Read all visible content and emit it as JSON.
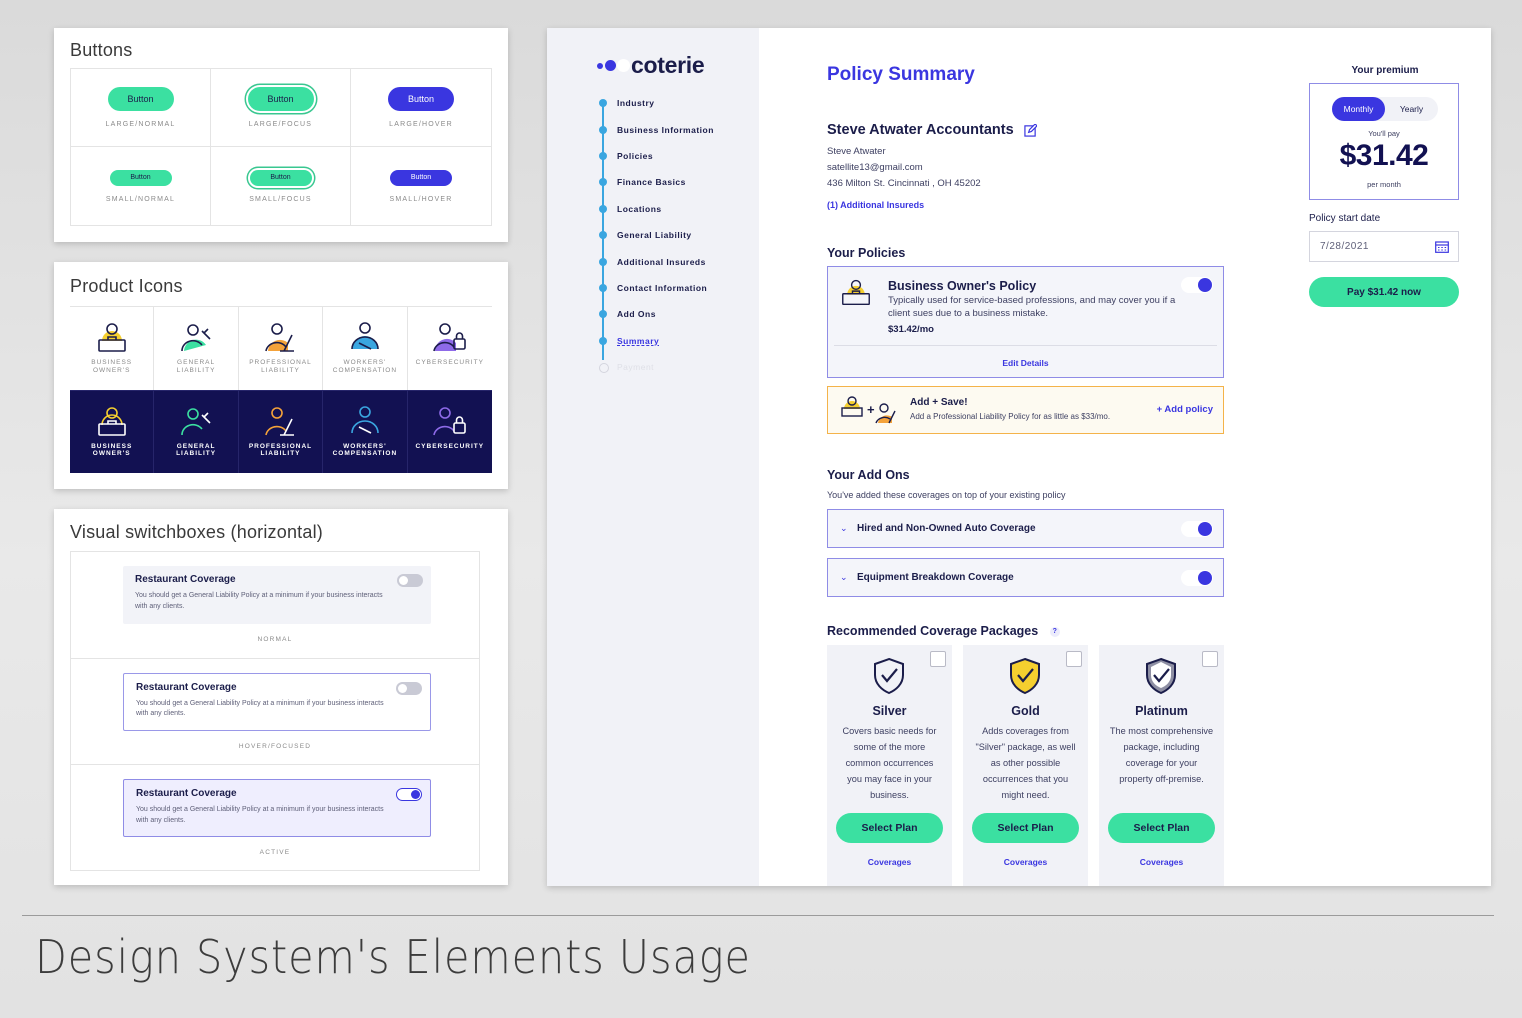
{
  "buttons_panel": {
    "title": "Buttons",
    "cells": [
      {
        "label": "Button",
        "caption": "LARGE/NORMAL"
      },
      {
        "label": "Button",
        "caption": "LARGE/FOCUS"
      },
      {
        "label": "Button",
        "caption": "LARGE/HOVER"
      },
      {
        "label": "Button",
        "caption": "SMALL/NORMAL"
      },
      {
        "label": "Button",
        "caption": "SMALL/FOCUS"
      },
      {
        "label": "Button",
        "caption": "SMALL/HOVER"
      }
    ]
  },
  "icons_panel": {
    "title": "Product Icons",
    "labels": [
      "BUSINESS OWNER'S",
      "GENERAL LIABILITY",
      "PROFESSIONAL LIABILITY",
      "WORKERS' COMPENSATION",
      "CYBERSECURITY"
    ]
  },
  "switch_panel": {
    "title": "Visual switchboxes (horizontal)",
    "rows": [
      {
        "title": "Restaurant Coverage",
        "desc": "You should get a General Liability Policy at a minimum if your business interacts with any clients.",
        "caption": "NORMAL"
      },
      {
        "title": "Restaurant Coverage",
        "desc": "You should get a General Liability Policy at a minimum if your business interacts with any clients.",
        "caption": "HOVER/FOCUSED"
      },
      {
        "title": "Restaurant Coverage",
        "desc": "You should get a General Liability Policy at a minimum if your business interacts with any clients.",
        "caption": "ACTIVE"
      }
    ]
  },
  "app": {
    "logo": "coterie",
    "steps": [
      "Industry",
      "Business Information",
      "Policies",
      "Finance Basics",
      "Locations",
      "General Liability",
      "Additional Insureds",
      "Contact Information",
      "Add Ons",
      "Summary",
      "Payment"
    ],
    "page_title": "Policy Summary",
    "business": {
      "name": "Steve Atwater Accountants",
      "owner": "Steve Atwater",
      "email": "satellite13@gmail.com",
      "address": "436 Milton St. Cincinnati , OH 45202",
      "additional_insureds": "(1) Additional Insureds"
    },
    "policies": {
      "heading": "Your Policies",
      "title": "Business Owner's Policy",
      "desc": "Typically used for service-based professions, and may cover you if a client sues due to a business mistake.",
      "price": "$31.42/mo",
      "edit": "Edit Details"
    },
    "promo": {
      "title": "Add + Save!",
      "desc": "Add a Professional Liability Policy for as little as $33/mo.",
      "link": "+ Add policy"
    },
    "addons": {
      "heading": "Your Add Ons",
      "sub": "You've added these coverages on top of your existing policy",
      "items": [
        "Hired and Non-Owned Auto Coverage",
        "Equipment Breakdown Coverage"
      ]
    },
    "packages": {
      "heading": "Recommended Coverage Packages",
      "help": "?",
      "items": [
        {
          "name": "Silver",
          "desc": "Covers basic needs for some of the more common occurrences you may face in your business.",
          "button": "Select Plan",
          "link": "Coverages"
        },
        {
          "name": "Gold",
          "desc": "Adds coverages from \"Silver\" package, as well as other possible occurrences that you might need.",
          "button": "Select Plan",
          "link": "Coverages"
        },
        {
          "name": "Platinum",
          "desc": "The most comprehensive package, including coverage for your property off-premise.",
          "button": "Select Plan",
          "link": "Coverages"
        }
      ]
    },
    "premium": {
      "label": "Your premium",
      "toggle_monthly": "Monthly",
      "toggle_yearly": "Yearly",
      "pay_label": "You'll pay",
      "amount": "$31.42",
      "period": "per month",
      "start_label": "Policy start date",
      "start_date": "7/28/2021",
      "pay_button": "Pay $31.42 now"
    }
  },
  "footer_title": "Design System's Elements Usage",
  "colors": {
    "brand": "#3a36e0",
    "mint": "#3be0a1",
    "navy": "#121152",
    "accent_blue": "#3aa6e0",
    "promo_border": "#f4b34a"
  }
}
